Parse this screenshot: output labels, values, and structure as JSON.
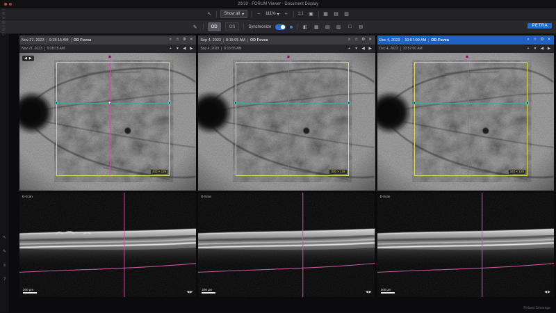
{
  "window": {
    "title": "20/20 - FORUM Viewer - Document Display"
  },
  "brand": {
    "side_text": "IMAGING",
    "badge": "PETRA",
    "watermark": "Roland Smeenge"
  },
  "toolbar": {
    "show_all": "Show all",
    "zoom_level": "111%",
    "actual_size": "1:1",
    "od_label": "OD",
    "os_label": "OS",
    "synchronize_label": "Synchronize"
  },
  "icons": {
    "pointer": "↖",
    "pencil": "✎",
    "dropdown": "▾",
    "zoom_in": "+",
    "zoom_out": "−",
    "fit": "▣",
    "grid": "▦",
    "rows": "▤",
    "cols": "▥",
    "split": "◧",
    "single": "□",
    "quad": "⊞",
    "search": "⌕",
    "star": "☆",
    "settings": "⚙",
    "close": "✕",
    "prev": "◀",
    "next": "▶",
    "layers": "≡",
    "help": "?",
    "plus": "+"
  },
  "colors": {
    "accent": "#1e62c4",
    "roi": "#d9d95c",
    "hline": "#46a5a5",
    "vline": "#cf52a6"
  },
  "panels": [
    {
      "header": {
        "date": "Nov 27, 2023",
        "time": "9:28:15 AM",
        "eye": "OD Fovea"
      },
      "subheader": {
        "date": "Nov 27, 2023",
        "time": "9:28:15 AM"
      },
      "roi_size": "343 × 128",
      "oct_label": "B-Scan",
      "scale_label": "200 µm"
    },
    {
      "header": {
        "date": "Sep 4, 2023",
        "time": "8:15:05 AM",
        "eye": "OD Fovea"
      },
      "subheader": {
        "date": "Sep 4, 2023",
        "time": "8:15:05 AM"
      },
      "roi_size": "345 × 128",
      "oct_label": "B-Scan",
      "scale_label": "200 µm"
    },
    {
      "header": {
        "date": "Dec 4, 2023",
        "time": "10:57:00 AM",
        "eye": "OD Fovea"
      },
      "subheader": {
        "date": "Dec 4, 2023",
        "time": "10:57:00 AM"
      },
      "roi_size": "340 × 128",
      "oct_label": "B-Scan",
      "scale_label": "200 µm"
    }
  ]
}
